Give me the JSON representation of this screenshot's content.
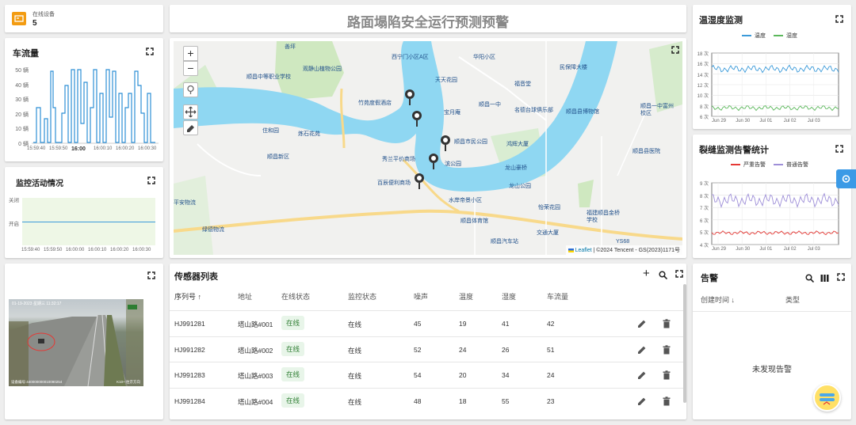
{
  "online": {
    "label": "在线设备",
    "count": "5"
  },
  "header": {
    "title": "路面塌陷安全运行预测预警"
  },
  "traffic": {
    "title": "车流量",
    "yticks": [
      "50 辆",
      "40 辆",
      "30 辆",
      "20 辆",
      "10 辆",
      "0 辆"
    ],
    "xticks": [
      "15:59:40",
      "15:59:50",
      "16:00",
      "16:00:10",
      "16:00:20",
      "16:00:30"
    ]
  },
  "monitor": {
    "title": "监控活动情况",
    "yticks": [
      "关闭",
      "开启"
    ],
    "xticks": [
      "15:59:40",
      "15:59:50",
      "16:00:00",
      "16:00:10",
      "16:00:20",
      "16:00:30"
    ]
  },
  "camera": {
    "timestamp": "01-19-2023 星期三 11:32:17",
    "footer_left": "设备编号:440000000010090254",
    "footer_right": "K10+ 往京方向"
  },
  "map": {
    "attribution_leaflet": "Leaflet",
    "attribution_rest": "| ©2024 Tencent - GS(2023)1171号",
    "labels": [
      {
        "text": "西宁门小区A区"
      },
      {
        "text": "华阳小区"
      },
      {
        "text": "观静山植物公园"
      },
      {
        "text": "顺昌中等职业学校"
      },
      {
        "text": "天天花园"
      },
      {
        "text": "福音堂"
      },
      {
        "text": "民保障大楼"
      },
      {
        "text": "竹苑度假酒店"
      },
      {
        "text": "宝月庵"
      },
      {
        "text": "顺昌一中"
      },
      {
        "text": "名德台球俱乐部"
      },
      {
        "text": "顺昌县博物馆"
      },
      {
        "text": "顺昌一中富州校区"
      },
      {
        "text": "住和园"
      },
      {
        "text": "炼石花苑"
      },
      {
        "text": "顺昌市民公园"
      },
      {
        "text": "鸿辉大厦"
      },
      {
        "text": "顺昌新区"
      },
      {
        "text": "秀兰平价商场"
      },
      {
        "text": "滨公园"
      },
      {
        "text": "龙山豪桥"
      },
      {
        "text": "顺昌县医院"
      },
      {
        "text": "百辰便利商场"
      },
      {
        "text": "龙山公园"
      },
      {
        "text": "平安物流"
      },
      {
        "text": "水岸帝景小区"
      },
      {
        "text": "怡荣花园"
      },
      {
        "text": "顺昌体育馆"
      },
      {
        "text": "福建顺昌金桥学校"
      },
      {
        "text": "绿德物流"
      },
      {
        "text": "顺昌汽车站"
      },
      {
        "text": "交通大厦"
      },
      {
        "text": "YS68"
      },
      {
        "text": "善坪"
      }
    ]
  },
  "sensors": {
    "title": "传感器列表",
    "columns": [
      "序列号",
      "地址",
      "在线状态",
      "监控状态",
      "噪声",
      "温度",
      "湿度",
      "车流量"
    ],
    "rows": [
      {
        "serial": "HJ991281",
        "address": "塔山路#001",
        "online": "在线",
        "monitor": "在线",
        "noise": "45",
        "temp": "19",
        "humidity": "41",
        "traffic": "42"
      },
      {
        "serial": "HJ991282",
        "address": "塔山路#002",
        "online": "在线",
        "monitor": "在线",
        "noise": "52",
        "temp": "24",
        "humidity": "26",
        "traffic": "51"
      },
      {
        "serial": "HJ991283",
        "address": "塔山路#003",
        "online": "在线",
        "monitor": "在线",
        "noise": "54",
        "temp": "20",
        "humidity": "34",
        "traffic": "24"
      },
      {
        "serial": "HJ991284",
        "address": "塔山路#004",
        "online": "在线",
        "monitor": "在线",
        "noise": "48",
        "temp": "18",
        "humidity": "55",
        "traffic": "23"
      }
    ]
  },
  "temp_humidity": {
    "title": "温湿度监测",
    "legend": [
      "温度",
      "湿度"
    ],
    "yticks": [
      "18 次",
      "16 次",
      "14 次",
      "12 次",
      "10 次",
      "8 次",
      "6 次"
    ],
    "xticks": [
      "Jun 29",
      "Jun 30",
      "Jul 01",
      "Jul 02",
      "Jul 03"
    ],
    "colors": {
      "temp": "#3b9ad9",
      "humidity": "#5cb85c"
    }
  },
  "crack": {
    "title": "裂缝监测告警统计",
    "legend": [
      "严重告警",
      "普通告警"
    ],
    "yticks": [
      "9 次",
      "8 次",
      "7 次",
      "6 次",
      "5 次",
      "4 次"
    ],
    "xticks": [
      "Jun 29",
      "Jun 30",
      "Jul 01",
      "Jul 02",
      "Jul 03"
    ],
    "colors": {
      "severe": "#e53935",
      "normal": "#9e8fd8"
    }
  },
  "alerts": {
    "title": "告警",
    "col_time": "创建时间",
    "col_type": "类型",
    "empty": "未发现告警"
  }
}
